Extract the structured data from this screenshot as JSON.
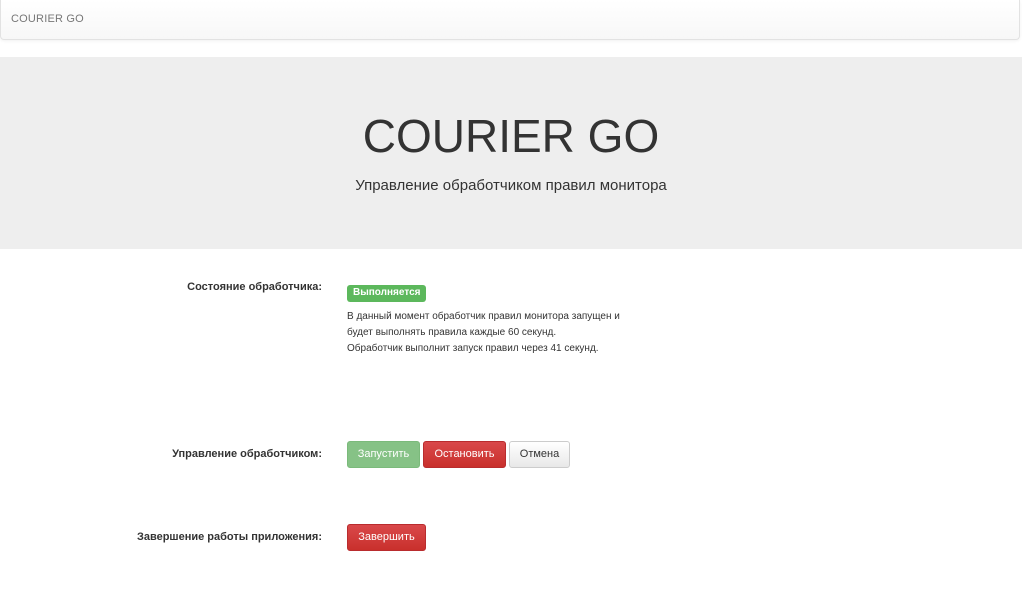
{
  "navbar": {
    "brand": "COURIER GO"
  },
  "jumbotron": {
    "title": "COURIER GO",
    "subtitle": "Управление обработчиком правил монитора"
  },
  "status": {
    "label": "Состояние обработчика:",
    "badge": "Выполняется",
    "badge_color": "#5cb85c",
    "line1": "В данный момент обработчик правил монитора запущен и",
    "line2": "будет выполнять правила каждые 60 секунд.",
    "line3": "Обработчик выполнит запуск правил через 41 секунд."
  },
  "control": {
    "label": "Управление обработчиком:",
    "start_button": "Запустить",
    "stop_button": "Остановить",
    "cancel_button": "Отмена"
  },
  "shutdown": {
    "label": "Завершение работы приложения:",
    "finish_button": "Завершить"
  },
  "colors": {
    "danger": "#d9383a",
    "success": "#5cb85c",
    "jumbotron_bg": "#eeeeee"
  }
}
